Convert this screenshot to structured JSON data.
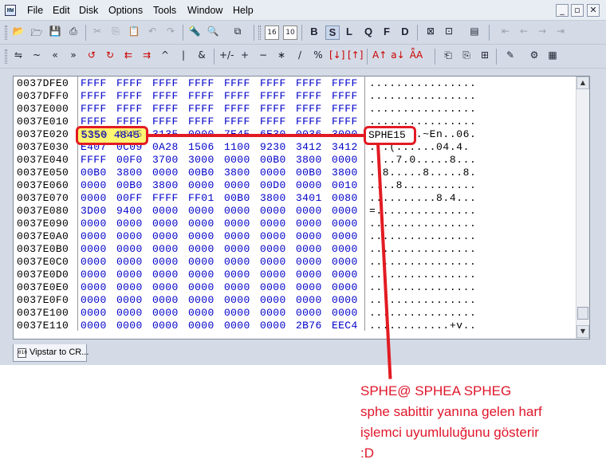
{
  "menubar": {
    "items": [
      "File",
      "Edit",
      "Disk",
      "Options",
      "Tools",
      "Window",
      "Help"
    ]
  },
  "toolbar1": {
    "icons": [
      "open-icon",
      "open-folder-icon",
      "save-icon",
      "print-icon",
      "cut-icon",
      "copy-icon",
      "paste-icon",
      "undo-icon",
      "redo-icon",
      "find-icon",
      "find-replace-icon",
      "clipboard-icon",
      "hex16-icon",
      "dec10-icon",
      "bookmark-icon",
      "sidebar-icon",
      "first-icon",
      "back-icon",
      "forward-icon",
      "last-icon"
    ],
    "view_buttons": [
      "B",
      "S",
      "L",
      "Q",
      "F",
      "D"
    ],
    "hex16_label": "16",
    "dec10_label": "10"
  },
  "toolbar2": {
    "ops": [
      "⇋",
      "~",
      "«",
      "»",
      "↺",
      "↻",
      "⇇",
      "⇉",
      "^",
      "|",
      "&",
      "+/-",
      "+",
      "−",
      "∗",
      "/",
      "%",
      "[↓]",
      "[↑]",
      "A↑",
      "a↓",
      "ǞA"
    ]
  },
  "hexview": {
    "rows": [
      {
        "addr": "0037DFE0",
        "hex": [
          "FFFF",
          "FFFF",
          "FFFF",
          "FFFF",
          "FFFF",
          "FFFF",
          "FFFF",
          "FFFF"
        ],
        "ascii": "................"
      },
      {
        "addr": "0037DFF0",
        "hex": [
          "FFFF",
          "FFFF",
          "FFFF",
          "FFFF",
          "FFFF",
          "FFFF",
          "FFFF",
          "FFFF"
        ],
        "ascii": "................"
      },
      {
        "addr": "0037E000",
        "hex": [
          "FFFF",
          "FFFF",
          "FFFF",
          "FFFF",
          "FFFF",
          "FFFF",
          "FFFF",
          "FFFF"
        ],
        "ascii": "................"
      },
      {
        "addr": "0037E010",
        "hex": [
          "FFFF",
          "FFFF",
          "FFFF",
          "FFFF",
          "FFFF",
          "FFFF",
          "FFFF",
          "FFFF"
        ],
        "ascii": "................"
      },
      {
        "addr": "0037E020",
        "hex": [
          "5350",
          "4845",
          "3135",
          "0000",
          "7E45",
          "6E30",
          "0036",
          "3000"
        ],
        "ascii": "SPHE15..~En..06."
      },
      {
        "addr": "0037E030",
        "hex": [
          "E407",
          "0C09",
          "0A28",
          "1506",
          "1100",
          "9230",
          "3412",
          "3412"
        ],
        "ascii": "...(......04.4."
      },
      {
        "addr": "0037E040",
        "hex": [
          "FFFF",
          "00F0",
          "3700",
          "3000",
          "0000",
          "00B0",
          "3800",
          "0000"
        ],
        "ascii": "....7.0.....8..."
      },
      {
        "addr": "0037E050",
        "hex": [
          "00B0",
          "3800",
          "0000",
          "00B0",
          "3800",
          "0000",
          "00B0",
          "3800"
        ],
        "ascii": "..8.....8.....8."
      },
      {
        "addr": "0037E060",
        "hex": [
          "0000",
          "00B0",
          "3800",
          "0000",
          "0000",
          "00D0",
          "0000",
          "0010"
        ],
        "ascii": "....8..........."
      },
      {
        "addr": "0037E070",
        "hex": [
          "0000",
          "00FF",
          "FFFF",
          "FF01",
          "00B0",
          "3800",
          "3401",
          "0080"
        ],
        "ascii": "..........8.4..."
      },
      {
        "addr": "0037E080",
        "hex": [
          "3D00",
          "9400",
          "0000",
          "0000",
          "0000",
          "0000",
          "0000",
          "0000"
        ],
        "ascii": "=..............."
      },
      {
        "addr": "0037E090",
        "hex": [
          "0000",
          "0000",
          "0000",
          "0000",
          "0000",
          "0000",
          "0000",
          "0000"
        ],
        "ascii": "................"
      },
      {
        "addr": "0037E0A0",
        "hex": [
          "0000",
          "0000",
          "0000",
          "0000",
          "0000",
          "0000",
          "0000",
          "0000"
        ],
        "ascii": "................"
      },
      {
        "addr": "0037E0B0",
        "hex": [
          "0000",
          "0000",
          "0000",
          "0000",
          "0000",
          "0000",
          "0000",
          "0000"
        ],
        "ascii": "................"
      },
      {
        "addr": "0037E0C0",
        "hex": [
          "0000",
          "0000",
          "0000",
          "0000",
          "0000",
          "0000",
          "0000",
          "0000"
        ],
        "ascii": "................"
      },
      {
        "addr": "0037E0D0",
        "hex": [
          "0000",
          "0000",
          "0000",
          "0000",
          "0000",
          "0000",
          "0000",
          "0000"
        ],
        "ascii": "................"
      },
      {
        "addr": "0037E0E0",
        "hex": [
          "0000",
          "0000",
          "0000",
          "0000",
          "0000",
          "0000",
          "0000",
          "0000"
        ],
        "ascii": "................"
      },
      {
        "addr": "0037E0F0",
        "hex": [
          "0000",
          "0000",
          "0000",
          "0000",
          "0000",
          "0000",
          "0000",
          "0000"
        ],
        "ascii": "................"
      },
      {
        "addr": "0037E100",
        "hex": [
          "0000",
          "0000",
          "0000",
          "0000",
          "0000",
          "0000",
          "0000",
          "0000"
        ],
        "ascii": "................"
      },
      {
        "addr": "0037E110",
        "hex": [
          "0000",
          "0000",
          "0000",
          "0000",
          "0000",
          "0000",
          "2B76",
          "EEC4"
        ],
        "ascii": "............+v.."
      }
    ]
  },
  "highlight": {
    "hex_text": "5350 4845",
    "ascii_text": "SPHE15"
  },
  "tab": {
    "label": "Vipstar to CR..."
  },
  "caption": {
    "lines": [
      "SPHE@  SPHEA SPHEG",
      "sphe sabittir yanına gelen harf",
      "işlemci uyumluluğunu gösterir",
      ":D"
    ]
  },
  "colors": {
    "annotation_red": "#e21b23",
    "hex_blue": "#0000c8",
    "highlight_yellow": "#fff000"
  }
}
